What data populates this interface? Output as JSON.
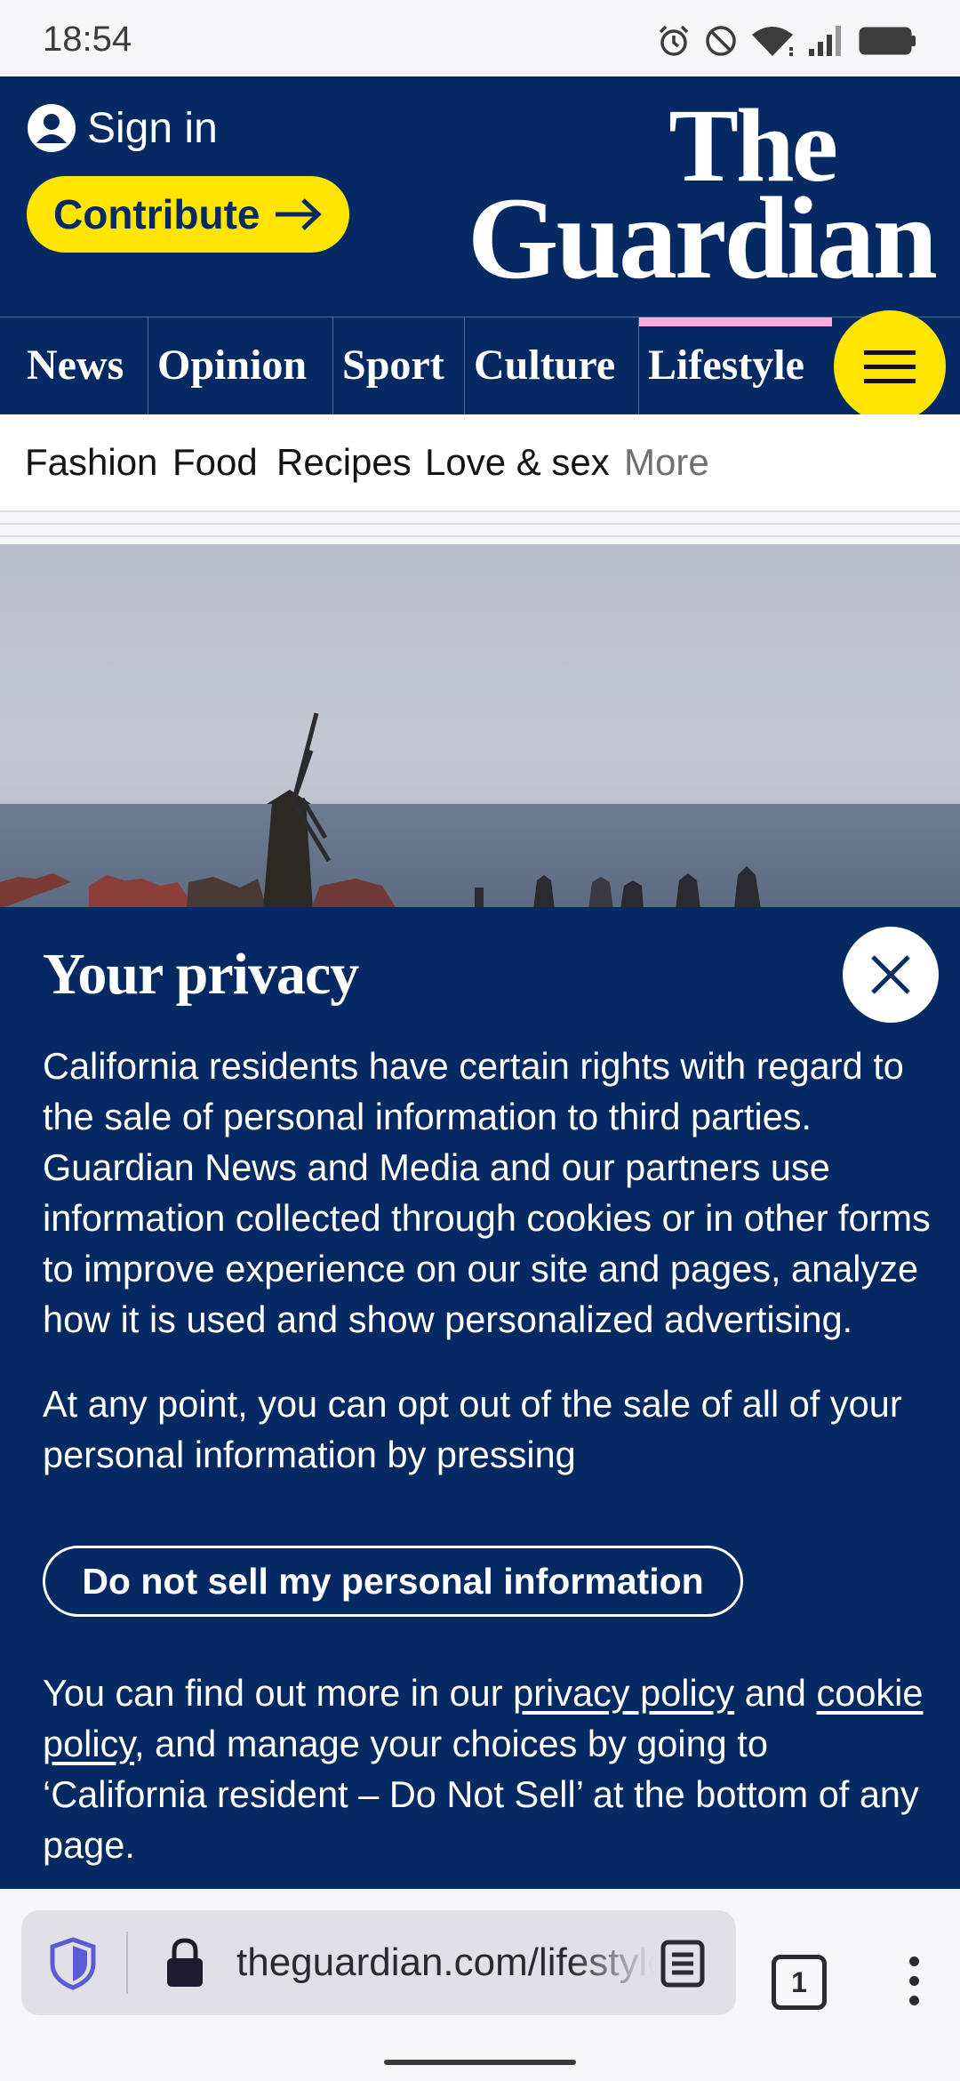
{
  "status_bar": {
    "time": "18:54",
    "icons": [
      "alarm-icon",
      "do-not-disturb-icon",
      "wifi-icon",
      "signal-icon",
      "battery-icon"
    ]
  },
  "header": {
    "sign_in_label": "Sign in",
    "contribute_label": "Contribute",
    "logo_line1": "The",
    "logo_line2": "Guardian",
    "colors": {
      "brand_blue": "#052962",
      "accent_yellow": "#ffe500",
      "lifestyle_pink": "#ffabdb"
    }
  },
  "pillars": [
    {
      "label": "News",
      "active": false
    },
    {
      "label": "Opinion",
      "active": false
    },
    {
      "label": "Sport",
      "active": false
    },
    {
      "label": "Culture",
      "active": false
    },
    {
      "label": "Lifestyle",
      "active": true
    }
  ],
  "subnav": [
    "Fashion",
    "Food",
    "Recipes",
    "Love & sex",
    "More"
  ],
  "privacy": {
    "title": "Your privacy",
    "p1": "California residents have certain rights with regard to the sale of personal information to third parties. Guardian News and Media and our partners use information collected through cookies or in other forms to improve experience on our site and pages, analyze how it is used and show personalized advertising.",
    "p2": "At any point, you can opt out of the sale of all of your personal information by pressing",
    "dns_button": "Do not sell my personal information",
    "p3_before": "You can find out more in our ",
    "privacy_policy_link": "privacy policy",
    "p3_and": " and ",
    "cookie_policy_link": "cookie policy",
    "p3_after": ", and manage your choices by going to ‘California resident – Do Not Sell’ at the bottom of any page."
  },
  "browser": {
    "url": "theguardian.com/lifestyle",
    "tab_count": "1"
  }
}
